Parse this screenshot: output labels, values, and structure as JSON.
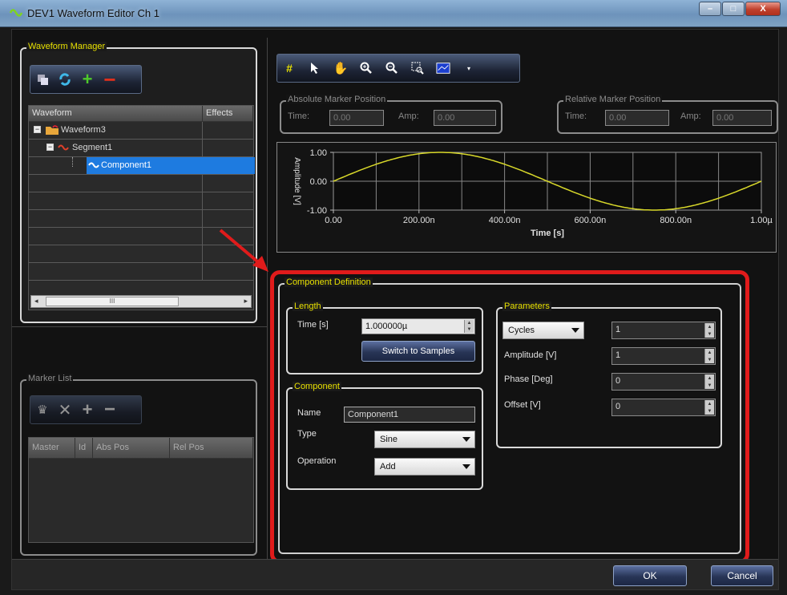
{
  "window": {
    "title": "DEV1 Waveform Editor Ch 1",
    "min_btn": "–",
    "max_btn": "□",
    "close_btn": "X"
  },
  "waveform_manager": {
    "legend": "Waveform Manager",
    "toolbar_icons": [
      "copy-icon",
      "refresh-icon",
      "add-icon",
      "remove-icon"
    ],
    "columns": [
      "Waveform",
      "Effects"
    ],
    "tree": [
      {
        "label": "Waveform3",
        "level": 0,
        "icon": "folder-icon",
        "selected": false
      },
      {
        "label": "Segment1",
        "level": 1,
        "icon": "segment-icon",
        "selected": false
      },
      {
        "label": "Component1",
        "level": 2,
        "icon": "sine-icon",
        "selected": true
      }
    ],
    "scroll_grip": "III"
  },
  "marker_list": {
    "legend": "Marker List",
    "columns": [
      "Master",
      "Id",
      "Abs Pos",
      "Rel Pos"
    ]
  },
  "chart_toolbar_icons": [
    "grid-icon",
    "pointer-icon",
    "pan-hand-icon",
    "zoom-in-icon",
    "zoom-out-icon",
    "zoom-fit-icon",
    "chart-view-icon",
    "dropdown-icon"
  ],
  "abs_marker": {
    "legend": "Absolute Marker Position",
    "time_label": "Time:",
    "time_value": "0.00",
    "amp_label": "Amp:",
    "amp_value": "0.00"
  },
  "rel_marker": {
    "legend": "Relative Marker Position",
    "time_label": "Time:",
    "time_value": "0.00",
    "amp_label": "Amp:",
    "amp_value": "0.00"
  },
  "chart_data": {
    "type": "line",
    "xlabel": "Time [s]",
    "ylabel": "Amplitude [V]",
    "xlim": [
      0,
      1e-06
    ],
    "ylim": [
      -1,
      1
    ],
    "x_ticks": [
      "0.00",
      "200.00n",
      "400.00n",
      "600.00n",
      "800.00n",
      "1.00µ"
    ],
    "y_ticks": [
      "1.00",
      "0.00",
      "-1.00"
    ],
    "series": [
      {
        "function": "sine",
        "amplitude": 1,
        "cycles": 1,
        "phase": 0,
        "offset": 0,
        "color": "#d8d82a"
      }
    ],
    "grid": true
  },
  "component_definition": {
    "legend": "Component Definition",
    "length": {
      "legend": "Length",
      "time_label": "Time [s]",
      "time_value": "1.000000µ",
      "switch_button": "Switch to Samples"
    },
    "component": {
      "legend": "Component",
      "name_label": "Name",
      "name_value": "Component1",
      "type_label": "Type",
      "type_value": "Sine",
      "operation_label": "Operation",
      "operation_value": "Add"
    },
    "parameters": {
      "legend": "Parameters",
      "rows": [
        {
          "label": "Cycles",
          "value": "1",
          "is_select": true
        },
        {
          "label": "Amplitude [V]",
          "value": "1",
          "is_select": false
        },
        {
          "label": "Phase [Deg]",
          "value": "0",
          "is_select": false
        },
        {
          "label": "Offset [V]",
          "value": "0",
          "is_select": false
        }
      ]
    }
  },
  "footer": {
    "ok": "OK",
    "cancel": "Cancel"
  },
  "colors": {
    "highlight": "#e01b1b",
    "legend": "#e8e000",
    "selection": "#1e7be0"
  }
}
